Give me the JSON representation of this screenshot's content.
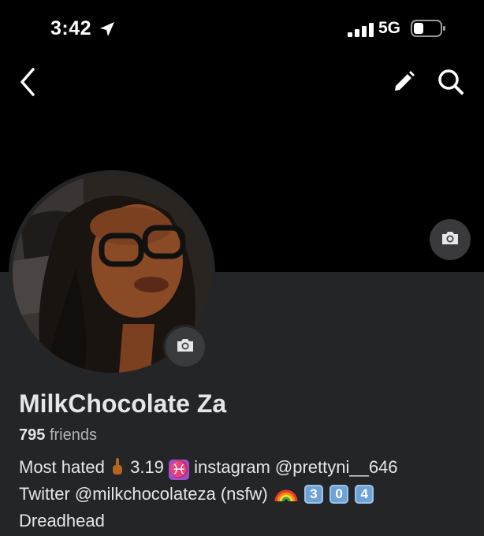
{
  "status_bar": {
    "time": "3:42",
    "network": "5G",
    "icons": [
      "location-arrow-icon",
      "signal-bars-icon",
      "battery-icon"
    ]
  },
  "nav": {
    "icons": [
      "back-chevron-icon",
      "edit-pencil-icon",
      "search-icon"
    ]
  },
  "profile": {
    "name": "MilkChocolate Za",
    "friends_count": "795",
    "friends_label": "friends",
    "bio": {
      "line1_prefix": "Most hated",
      "line1_number": "3.19",
      "line1_suffix": "instagram @prettyni__646",
      "line2_prefix": "Twitter @milkchocolateza (nsfw)",
      "keycaps": [
        "3",
        "0",
        "4"
      ],
      "line3": "Dreadhead",
      "emojis": [
        "middle-finger-emoji",
        "pisces-emoji",
        "rainbow-emoji",
        "keycap-3-emoji",
        "keycap-0-emoji",
        "keycap-4-emoji"
      ]
    }
  },
  "colors": {
    "background": "#000000",
    "panel": "#242526",
    "text_primary": "#e4e6eb",
    "text_secondary": "#b0b3b8"
  }
}
